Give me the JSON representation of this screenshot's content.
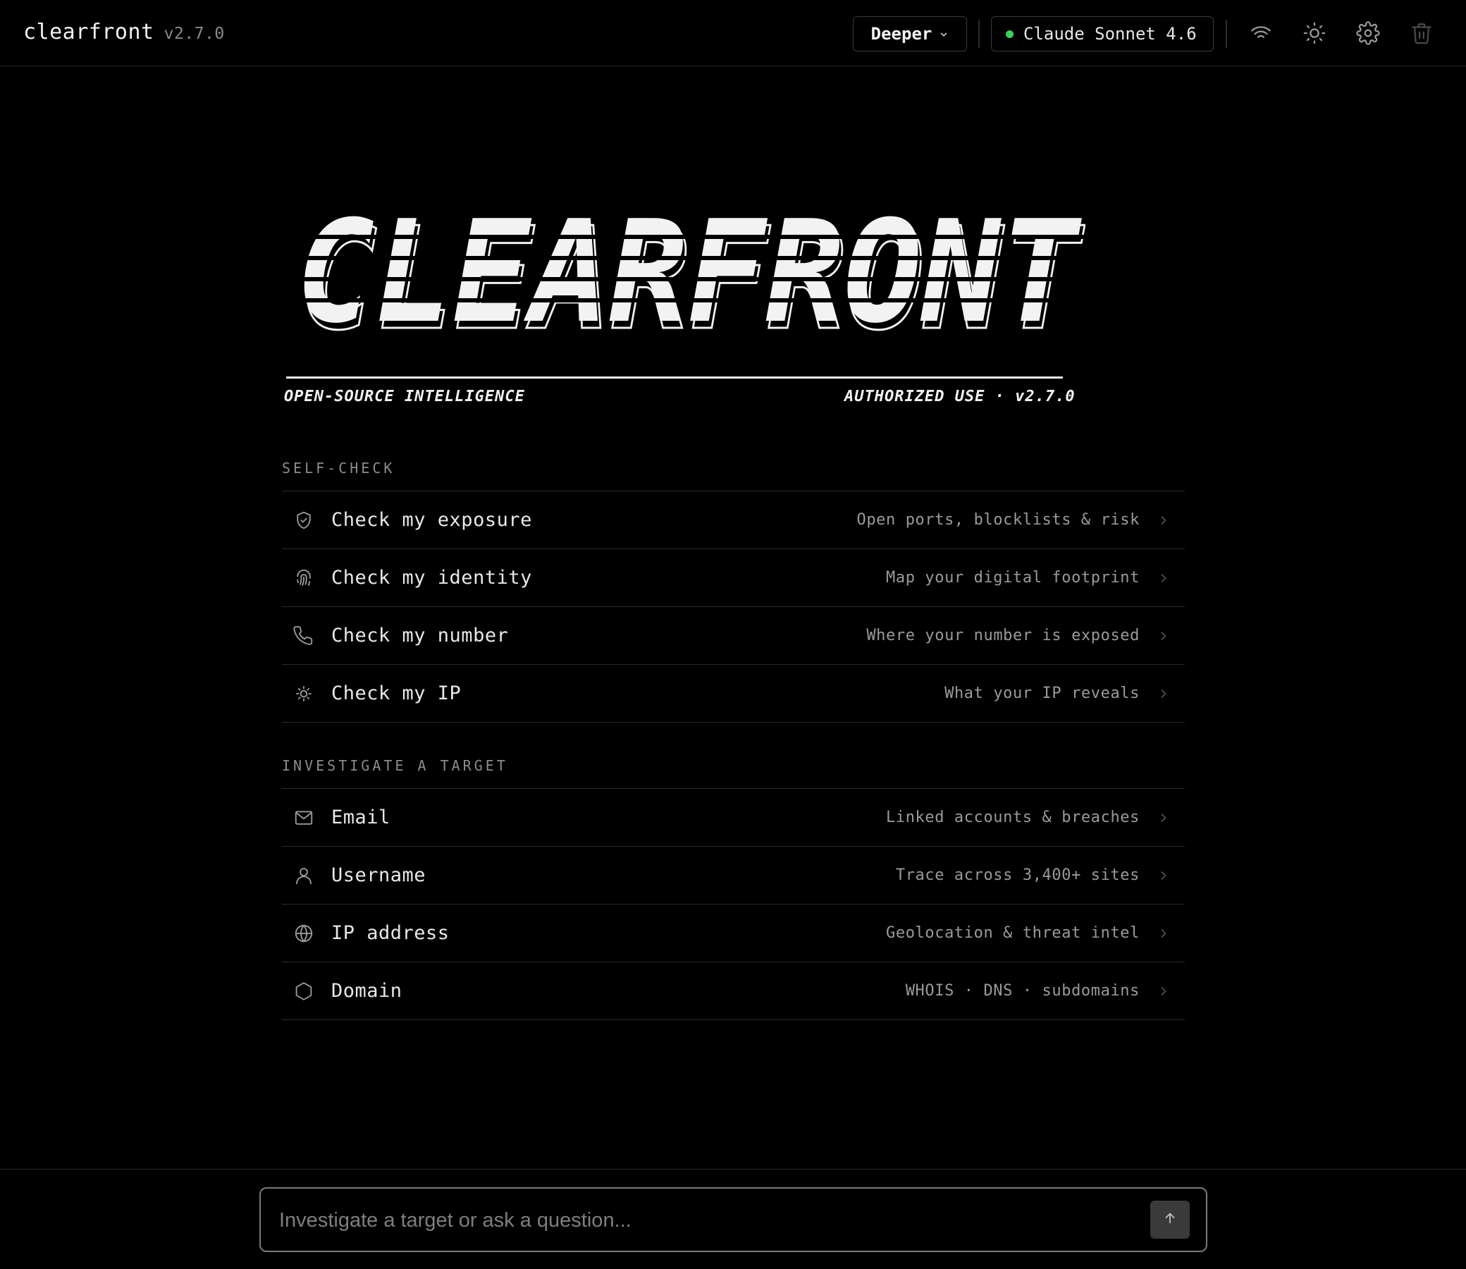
{
  "header": {
    "app_name": "clearfront",
    "version": "v2.7.0",
    "mode_label": "Deeper",
    "model_label": "Claude Sonnet 4.6",
    "status_color": "#3ad15a",
    "icons": [
      "wifi-icon",
      "sun-icon",
      "gear-icon",
      "trash-icon"
    ]
  },
  "hero": {
    "logo_text": "CLEARFRONT",
    "tagline_left": "OPEN-SOURCE INTELLIGENCE",
    "tagline_right": "AUTHORIZED USE · v2.7.0"
  },
  "self_check": {
    "title": "SELF-CHECK",
    "items": [
      {
        "label": "Check my exposure",
        "desc": "Open ports, blocklists & risk",
        "icon": "shield-icon"
      },
      {
        "label": "Check my identity",
        "desc": "Map your digital footprint",
        "icon": "fingerprint-icon"
      },
      {
        "label": "Check my number",
        "desc": "Where your number is exposed",
        "icon": "phone-icon"
      },
      {
        "label": "Check my IP",
        "desc": "What your IP reveals",
        "icon": "sun-icon"
      }
    ]
  },
  "investigate": {
    "title": "INVESTIGATE A TARGET",
    "items": [
      {
        "label": "Email",
        "desc": "Linked accounts & breaches",
        "icon": "mail-icon"
      },
      {
        "label": "Username",
        "desc": "Trace across 3,400+ sites",
        "icon": "user-icon"
      },
      {
        "label": "IP address",
        "desc": "Geolocation & threat intel",
        "icon": "globe-icon"
      },
      {
        "label": "Domain",
        "desc": "WHOIS · DNS · subdomains",
        "icon": "hexagon-icon"
      }
    ]
  },
  "prompt": {
    "placeholder": "Investigate a target or ask a question..."
  }
}
